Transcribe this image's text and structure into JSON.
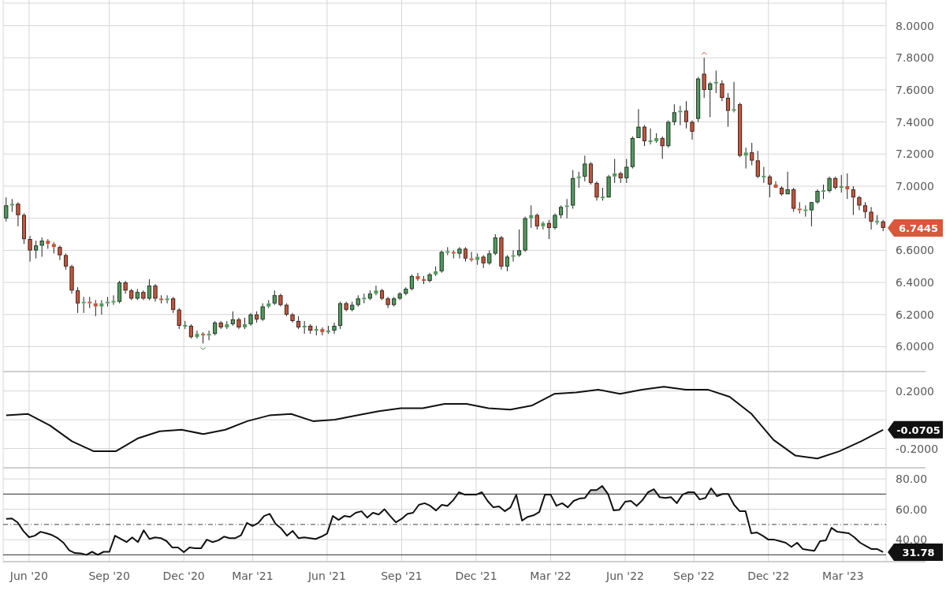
{
  "price_panel": {
    "last_price_tag": "6.7445",
    "chart_data": {
      "type": "candlestick",
      "grid": true,
      "ylim": [
        5.84,
        8.16
      ],
      "categories": [
        null,
        null,
        null,
        null,
        null,
        null,
        null,
        null,
        null,
        null,
        null,
        null,
        null,
        null,
        null,
        null,
        null,
        null,
        null,
        null,
        null,
        null,
        null,
        null,
        null,
        null,
        null,
        null,
        null,
        null,
        null,
        null,
        null,
        null,
        null,
        null,
        null,
        null,
        null,
        null,
        null,
        null,
        null,
        null,
        null,
        null,
        null,
        null,
        null,
        null,
        null,
        null,
        null,
        null,
        null,
        null,
        null,
        null,
        null,
        null,
        null,
        null,
        null,
        null,
        null,
        null,
        null,
        null,
        null,
        null,
        null,
        null,
        null,
        null,
        null,
        null,
        null,
        null,
        null,
        null,
        null,
        null,
        null,
        null,
        null,
        null,
        null,
        null,
        null,
        null,
        null,
        null,
        null,
        null,
        null,
        null,
        null,
        null,
        null,
        null,
        null,
        null,
        null,
        null,
        null,
        null,
        null,
        null,
        null,
        null,
        null,
        null,
        null,
        null,
        null,
        null,
        null,
        null,
        null,
        null,
        null,
        null,
        null,
        null,
        null,
        null,
        null,
        null,
        null,
        null,
        null,
        null,
        null,
        null,
        null,
        null,
        null,
        null,
        null,
        null,
        null,
        null,
        null,
        null,
        null,
        null,
        null,
        null
      ],
      "yticks": [
        {
          "value": 8.0,
          "label": "8.0000"
        },
        {
          "value": 7.8,
          "label": "7.8000"
        },
        {
          "value": 7.6,
          "label": "7.6000"
        },
        {
          "value": 7.4,
          "label": "7.4000"
        },
        {
          "value": 7.2,
          "label": "7.2000"
        },
        {
          "value": 7.0,
          "label": "7.0000"
        },
        {
          "value": 6.6,
          "label": "6.6000"
        },
        {
          "value": 6.4,
          "label": "6.4000"
        },
        {
          "value": 6.2,
          "label": "6.2000"
        },
        {
          "value": 6.0,
          "label": "6.0000"
        }
      ],
      "ohlc": [
        [
          6.8,
          6.93,
          6.78,
          6.88
        ],
        [
          6.88,
          6.92,
          6.84,
          6.89
        ],
        [
          6.89,
          6.9,
          6.75,
          6.82
        ],
        [
          6.82,
          6.83,
          6.64,
          6.67
        ],
        [
          6.67,
          6.69,
          6.53,
          6.6
        ],
        [
          6.6,
          6.66,
          6.55,
          6.63
        ],
        [
          6.63,
          6.68,
          6.56,
          6.66
        ],
        [
          6.66,
          6.67,
          6.61,
          6.64
        ],
        [
          6.64,
          6.65,
          6.58,
          6.62
        ],
        [
          6.62,
          6.63,
          6.54,
          6.57
        ],
        [
          6.57,
          6.58,
          6.48,
          6.5
        ],
        [
          6.5,
          6.51,
          6.33,
          6.35
        ],
        [
          6.35,
          6.37,
          6.21,
          6.27
        ],
        [
          6.27,
          6.31,
          6.21,
          6.28
        ],
        [
          6.28,
          6.31,
          6.24,
          6.27
        ],
        [
          6.27,
          6.29,
          6.19,
          6.25
        ],
        [
          6.25,
          6.29,
          6.2,
          6.27
        ],
        [
          6.27,
          6.31,
          6.25,
          6.28
        ],
        [
          6.28,
          6.32,
          6.26,
          6.28
        ],
        [
          6.28,
          6.41,
          6.27,
          6.4
        ],
        [
          6.4,
          6.41,
          6.33,
          6.35
        ],
        [
          6.35,
          6.36,
          6.29,
          6.3
        ],
        [
          6.3,
          6.36,
          6.29,
          6.34
        ],
        [
          6.34,
          6.35,
          6.29,
          6.3
        ],
        [
          6.3,
          6.42,
          6.29,
          6.38
        ],
        [
          6.38,
          6.39,
          6.28,
          6.3
        ],
        [
          6.3,
          6.32,
          6.27,
          6.29
        ],
        [
          6.29,
          6.32,
          6.27,
          6.3
        ],
        [
          6.3,
          6.31,
          6.21,
          6.23
        ],
        [
          6.23,
          6.24,
          6.11,
          6.13
        ],
        [
          6.13,
          6.16,
          6.11,
          6.13
        ],
        [
          6.13,
          6.14,
          6.05,
          6.06
        ],
        [
          6.06,
          6.1,
          6.05,
          6.08
        ],
        [
          6.08,
          6.09,
          6.02,
          6.07
        ],
        [
          6.07,
          6.1,
          6.04,
          6.08
        ],
        [
          6.08,
          6.16,
          6.07,
          6.15
        ],
        [
          6.15,
          6.16,
          6.11,
          6.12
        ],
        [
          6.12,
          6.16,
          6.11,
          6.14
        ],
        [
          6.14,
          6.22,
          6.13,
          6.17
        ],
        [
          6.17,
          6.18,
          6.11,
          6.12
        ],
        [
          6.12,
          6.18,
          6.11,
          6.14
        ],
        [
          6.14,
          6.21,
          6.13,
          6.2
        ],
        [
          6.2,
          6.22,
          6.15,
          6.17
        ],
        [
          6.17,
          6.27,
          6.16,
          6.25
        ],
        [
          6.25,
          6.29,
          6.24,
          6.27
        ],
        [
          6.27,
          6.35,
          6.26,
          6.32
        ],
        [
          6.32,
          6.33,
          6.25,
          6.26
        ],
        [
          6.26,
          6.27,
          6.19,
          6.2
        ],
        [
          6.2,
          6.21,
          6.15,
          6.16
        ],
        [
          6.16,
          6.19,
          6.11,
          6.12
        ],
        [
          6.12,
          6.16,
          6.08,
          6.13
        ],
        [
          6.13,
          6.14,
          6.08,
          6.1
        ],
        [
          6.1,
          6.13,
          6.07,
          6.11
        ],
        [
          6.11,
          6.12,
          6.07,
          6.09
        ],
        [
          6.09,
          6.13,
          6.08,
          6.1
        ],
        [
          6.1,
          6.15,
          6.08,
          6.13
        ],
        [
          6.13,
          6.28,
          6.11,
          6.27
        ],
        [
          6.27,
          6.28,
          6.22,
          6.23
        ],
        [
          6.23,
          6.28,
          6.22,
          6.26
        ],
        [
          6.26,
          6.32,
          6.25,
          6.3
        ],
        [
          6.3,
          6.33,
          6.27,
          6.3
        ],
        [
          6.3,
          6.35,
          6.29,
          6.33
        ],
        [
          6.33,
          6.38,
          6.32,
          6.35
        ],
        [
          6.35,
          6.36,
          6.29,
          6.3
        ],
        [
          6.3,
          6.31,
          6.24,
          6.26
        ],
        [
          6.26,
          6.31,
          6.25,
          6.3
        ],
        [
          6.3,
          6.34,
          6.29,
          6.33
        ],
        [
          6.33,
          6.37,
          6.32,
          6.36
        ],
        [
          6.36,
          6.45,
          6.35,
          6.44
        ],
        [
          6.44,
          6.46,
          6.41,
          6.42
        ],
        [
          6.42,
          6.44,
          6.39,
          6.41
        ],
        [
          6.41,
          6.46,
          6.4,
          6.45
        ],
        [
          6.45,
          6.5,
          6.44,
          6.47
        ],
        [
          6.47,
          6.6,
          6.46,
          6.59
        ],
        [
          6.59,
          6.62,
          6.57,
          6.59
        ],
        [
          6.59,
          6.6,
          6.55,
          6.58
        ],
        [
          6.58,
          6.62,
          6.55,
          6.61
        ],
        [
          6.61,
          6.62,
          6.53,
          6.55
        ],
        [
          6.55,
          6.59,
          6.53,
          6.54
        ],
        [
          6.54,
          6.58,
          6.51,
          6.56
        ],
        [
          6.56,
          6.57,
          6.49,
          6.52
        ],
        [
          6.52,
          6.6,
          6.51,
          6.58
        ],
        [
          6.58,
          6.7,
          6.57,
          6.68
        ],
        [
          6.68,
          6.69,
          6.48,
          6.5
        ],
        [
          6.5,
          6.57,
          6.47,
          6.56
        ],
        [
          6.56,
          6.6,
          6.53,
          6.57
        ],
        [
          6.57,
          6.73,
          6.56,
          6.6
        ],
        [
          6.6,
          6.81,
          6.59,
          6.8
        ],
        [
          6.8,
          6.88,
          6.74,
          6.82
        ],
        [
          6.82,
          6.83,
          6.73,
          6.75
        ],
        [
          6.75,
          6.78,
          6.73,
          6.77
        ],
        [
          6.77,
          6.79,
          6.67,
          6.74
        ],
        [
          6.74,
          6.83,
          6.73,
          6.82
        ],
        [
          6.82,
          6.88,
          6.8,
          6.87
        ],
        [
          6.87,
          6.92,
          6.8,
          6.88
        ],
        [
          6.88,
          7.1,
          6.86,
          7.05
        ],
        [
          7.05,
          7.09,
          6.99,
          7.06
        ],
        [
          7.06,
          7.19,
          7.03,
          7.14
        ],
        [
          7.14,
          7.15,
          7.01,
          7.02
        ],
        [
          7.02,
          7.03,
          6.91,
          6.93
        ],
        [
          6.93,
          6.99,
          6.91,
          6.93
        ],
        [
          6.93,
          7.07,
          6.93,
          7.06
        ],
        [
          7.06,
          7.17,
          7.02,
          7.08
        ],
        [
          7.08,
          7.09,
          7.02,
          7.05
        ],
        [
          7.05,
          7.17,
          7.02,
          7.12
        ],
        [
          7.12,
          7.31,
          7.11,
          7.3
        ],
        [
          7.3,
          7.48,
          7.3,
          7.37
        ],
        [
          7.37,
          7.38,
          7.25,
          7.28
        ],
        [
          7.28,
          7.36,
          7.26,
          7.28
        ],
        [
          7.28,
          7.33,
          7.27,
          7.3
        ],
        [
          7.3,
          7.31,
          7.17,
          7.25
        ],
        [
          7.25,
          7.41,
          7.24,
          7.4
        ],
        [
          7.4,
          7.51,
          7.38,
          7.46
        ],
        [
          7.46,
          7.5,
          7.38,
          7.47
        ],
        [
          7.47,
          7.53,
          7.36,
          7.4
        ],
        [
          7.4,
          7.41,
          7.29,
          7.34
        ],
        [
          7.42,
          7.68,
          7.4,
          7.67
        ],
        [
          7.7,
          7.8,
          7.55,
          7.6
        ],
        [
          7.6,
          7.65,
          7.43,
          7.64
        ],
        [
          7.64,
          7.72,
          7.58,
          7.65
        ],
        [
          7.64,
          7.66,
          7.53,
          7.55
        ],
        [
          7.55,
          7.58,
          7.37,
          7.47
        ],
        [
          7.47,
          7.65,
          7.46,
          7.48
        ],
        [
          7.51,
          7.52,
          7.18,
          7.19
        ],
        [
          7.19,
          7.24,
          7.11,
          7.21
        ],
        [
          7.21,
          7.27,
          7.13,
          7.16
        ],
        [
          7.16,
          7.22,
          7.05,
          7.06
        ],
        [
          7.06,
          7.12,
          7.02,
          7.06
        ],
        [
          7.06,
          7.07,
          6.93,
          7.01
        ],
        [
          7.01,
          7.03,
          6.99,
          6.99
        ],
        [
          6.99,
          7.0,
          6.94,
          6.95
        ],
        [
          6.95,
          7.09,
          6.95,
          6.98
        ],
        [
          6.98,
          6.99,
          6.84,
          6.86
        ],
        [
          6.86,
          6.9,
          6.83,
          6.85
        ],
        [
          6.85,
          6.88,
          6.81,
          6.85
        ],
        [
          6.85,
          6.9,
          6.75,
          6.9
        ],
        [
          6.9,
          6.98,
          6.89,
          6.97
        ],
        [
          6.97,
          7.01,
          6.92,
          6.97
        ],
        [
          6.97,
          7.06,
          6.96,
          7.05
        ],
        [
          7.05,
          7.06,
          6.98,
          6.99
        ],
        [
          6.99,
          7.07,
          6.96,
          7.0
        ],
        [
          7.0,
          7.08,
          6.92,
          6.98
        ],
        [
          6.98,
          7.0,
          6.82,
          6.93
        ],
        [
          6.93,
          6.94,
          6.85,
          6.88
        ],
        [
          6.88,
          6.9,
          6.8,
          6.84
        ],
        [
          6.84,
          6.87,
          6.73,
          6.78
        ],
        [
          6.78,
          6.82,
          6.76,
          6.78
        ],
        [
          6.78,
          6.79,
          6.72,
          6.74
        ]
      ]
    }
  },
  "oscillator_panel": {
    "last_value_tag": "-0.0705",
    "chart_data": {
      "type": "line",
      "grid": true,
      "ylim": [
        -0.34,
        0.33
      ],
      "categories": [
        null,
        null,
        null,
        null,
        null,
        null,
        null,
        null,
        null,
        null,
        null,
        null,
        null,
        null,
        null,
        null,
        null,
        null,
        null,
        null,
        null,
        null,
        null,
        null,
        null,
        null,
        null,
        null,
        null,
        null,
        null,
        null,
        null,
        null,
        null,
        null,
        null,
        null,
        null,
        null,
        null
      ],
      "yticks": [
        {
          "value": 0.2,
          "label": "0.2000"
        },
        {
          "value": -0.2,
          "label": "-0.2000"
        }
      ],
      "series": [
        {
          "color": "#111111",
          "values": [
            0.03,
            0.04,
            -0.04,
            -0.15,
            -0.22,
            -0.22,
            -0.13,
            -0.08,
            -0.07,
            -0.1,
            -0.07,
            -0.01,
            0.03,
            0.04,
            -0.01,
            0.0,
            0.03,
            0.06,
            0.08,
            0.08,
            0.11,
            0.11,
            0.08,
            0.07,
            0.1,
            0.18,
            0.19,
            0.21,
            0.18,
            0.21,
            0.23,
            0.21,
            0.21,
            0.16,
            0.04,
            -0.14,
            -0.25,
            -0.27,
            -0.22,
            -0.15,
            -0.07
          ]
        }
      ]
    }
  },
  "rsi_panel": {
    "last_value_tag": "31.78",
    "chart_data": {
      "type": "line",
      "grid": true,
      "ylim": [
        25,
        86.8
      ],
      "categories": [
        null,
        null,
        null,
        null,
        "Jun '20",
        null,
        null,
        null,
        null,
        null,
        null,
        null,
        null,
        null,
        null,
        null,
        null,
        null,
        "Sep '20",
        null,
        null,
        null,
        null,
        null,
        null,
        null,
        null,
        null,
        null,
        null,
        null,
        "Dec '20",
        null,
        null,
        null,
        null,
        null,
        null,
        null,
        null,
        null,
        null,
        null,
        "Mar '21",
        null,
        null,
        null,
        null,
        null,
        null,
        null,
        null,
        null,
        null,
        null,
        null,
        "Jun '21",
        null,
        null,
        null,
        null,
        null,
        null,
        null,
        null,
        null,
        null,
        null,
        null,
        "Sep '21",
        null,
        null,
        null,
        null,
        null,
        null,
        null,
        null,
        null,
        null,
        null,
        null,
        "Dec '21",
        null,
        null,
        null,
        null,
        null,
        null,
        null,
        null,
        null,
        null,
        null,
        null,
        "Mar '22",
        null,
        null,
        null,
        null,
        null,
        null,
        null,
        null,
        null,
        null,
        null,
        null,
        "Jun '22",
        null,
        null,
        null,
        null,
        null,
        null,
        null,
        null,
        null,
        null,
        null,
        "Sep '22",
        null,
        null,
        null,
        null,
        null,
        null,
        null,
        null,
        null,
        null,
        null,
        null,
        "Dec '22",
        null,
        null,
        null,
        null,
        null,
        null,
        null,
        null,
        null,
        null,
        null,
        null,
        "Mar '23",
        null,
        null,
        null,
        null,
        null,
        null,
        null
      ],
      "yticks": [
        {
          "value": 80,
          "label": "80.00"
        },
        {
          "value": 60,
          "label": "60.00"
        },
        {
          "value": 40,
          "label": "40.00"
        }
      ],
      "ref_lines": [
        {
          "axis": "y",
          "value": 70
        },
        {
          "axis": "y",
          "value": 50
        },
        {
          "axis": "y",
          "value": 30
        }
      ],
      "series": [
        {
          "color": "#111111",
          "values": [
            53.7,
            54,
            51.4,
            45.7,
            41.6,
            42.6,
            45.2,
            44.2,
            43,
            41,
            38,
            33,
            31.2,
            31,
            30,
            32,
            30,
            32,
            32,
            42.6,
            40.5,
            38.4,
            41.5,
            38.4,
            46.2,
            40.5,
            41.5,
            41,
            39,
            34.8,
            34.8,
            31.7,
            34.8,
            34.3,
            34.3,
            40,
            38.4,
            39.5,
            42,
            41,
            41,
            43,
            51,
            49,
            51,
            55.6,
            57,
            50.4,
            47.3,
            42.6,
            45.7,
            41,
            41.5,
            41,
            40.5,
            42,
            44,
            55.6,
            53,
            55.6,
            55,
            57.7,
            58.7,
            54.5,
            57.7,
            56.6,
            60,
            55.6,
            51.4,
            53.7,
            57,
            57.7,
            62.9,
            64,
            62.3,
            59.2,
            62.9,
            62.3,
            66,
            71.2,
            69.6,
            69.6,
            69.6,
            71.2,
            65.5,
            61.3,
            61.8,
            58.7,
            61.3,
            69.6,
            52.5,
            55,
            56,
            58.2,
            69.6,
            69.6,
            62.3,
            64,
            61.3,
            65.5,
            67,
            67.5,
            72.7,
            72.7,
            75.3,
            70.1,
            59.2,
            59.7,
            65,
            65.5,
            62.3,
            66,
            71.2,
            73.2,
            68,
            67.5,
            68,
            64,
            69.6,
            71.2,
            71.2,
            66.5,
            67.5,
            73.8,
            68.6,
            70.1,
            70.1,
            62.9,
            58.7,
            58.7,
            44.2,
            44.7,
            42.6,
            40,
            40,
            39,
            38,
            35.3,
            38,
            33.8,
            33.2,
            32.7,
            39,
            39.5,
            47.8,
            45.2,
            44.7,
            44.2,
            41.5,
            38,
            35.8,
            33.8,
            33.8,
            31.8
          ]
        }
      ]
    }
  }
}
